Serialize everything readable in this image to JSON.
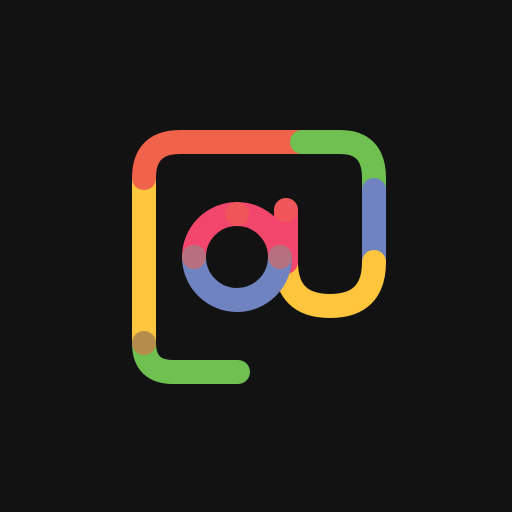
{
  "app_icon": {
    "name": "at-sign-logo",
    "background_color": "#121212",
    "palette": {
      "red": "#F06249",
      "green": "#6FC050",
      "blue": "#6F83C0",
      "yellow": "#FFC53D",
      "pink": "#F2466D"
    }
  }
}
